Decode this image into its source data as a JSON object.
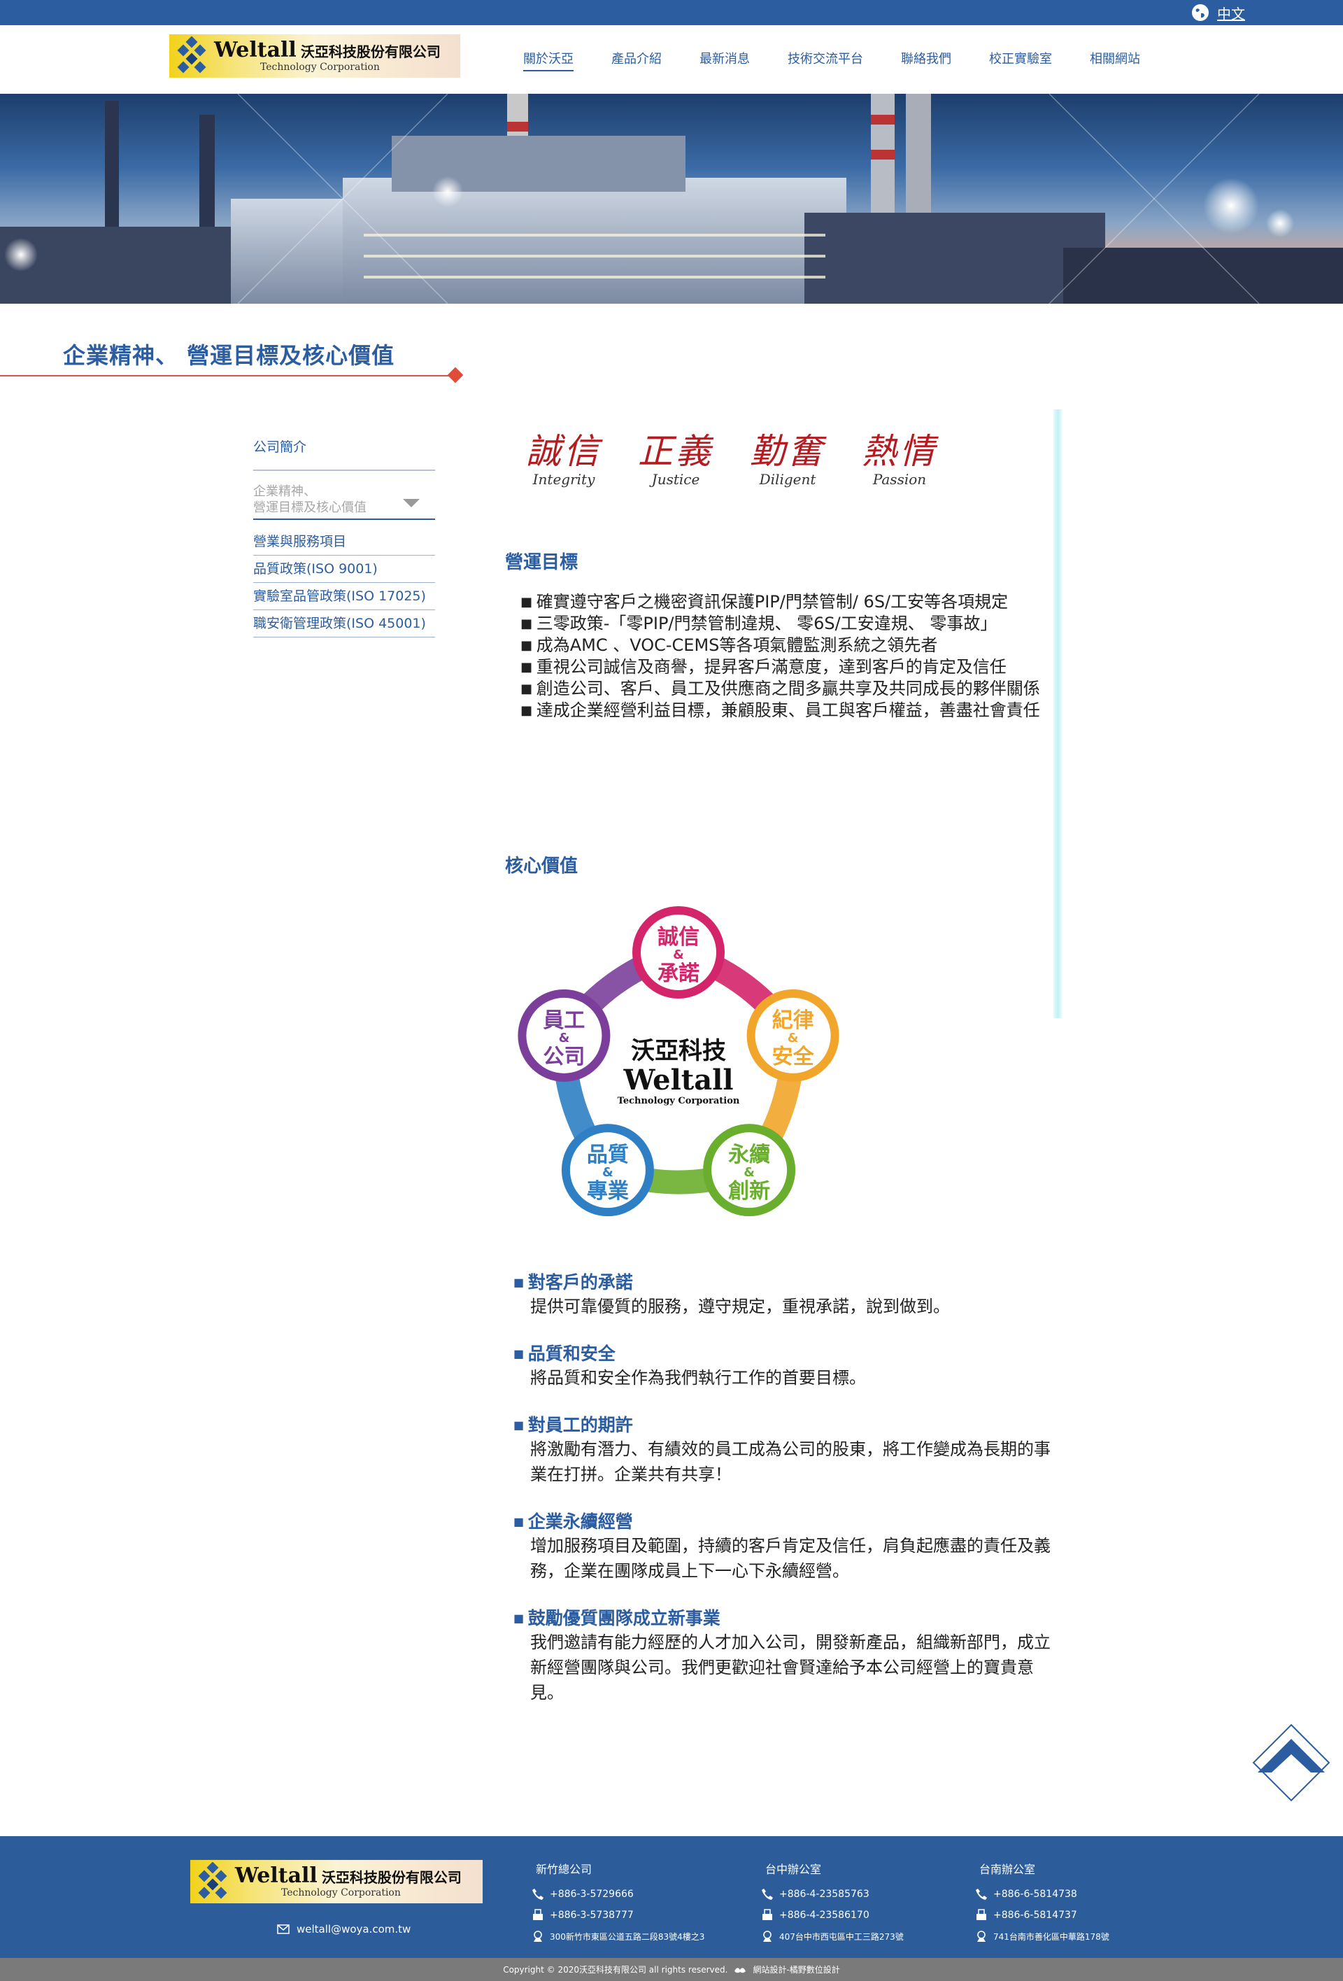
{
  "topbar": {
    "lang_label": "中文",
    "globe_icon": "globe-icon"
  },
  "brand": {
    "logo_en": "Weltall",
    "logo_cn": "沃亞科技股份有限公司",
    "logo_sub": "Technology Corporation"
  },
  "nav": {
    "items": [
      {
        "label": "關於沃亞",
        "active": true
      },
      {
        "label": "產品介紹"
      },
      {
        "label": "最新消息"
      },
      {
        "label": "技術交流平台"
      },
      {
        "label": "聯絡我們"
      },
      {
        "label": "校正實驗室"
      },
      {
        "label": "相關網站"
      }
    ]
  },
  "page": {
    "title": "企業精神、 營運目標及核心價值"
  },
  "sidebar": {
    "items": [
      {
        "label": "公司簡介"
      },
      {
        "label_line1": "企業精神、",
        "label_line2": "營運目標及核心價值",
        "current": true
      },
      {
        "label": "營業與服務項目"
      },
      {
        "label": "品質政策(ISO 9001)"
      },
      {
        "label": "實驗室品管政策(ISO 17025)"
      },
      {
        "label": "職安衛管理政策(ISO 45001)"
      }
    ]
  },
  "values": [
    {
      "cn": "誠信",
      "en": "Integrity"
    },
    {
      "cn": "正義",
      "en": "Justice"
    },
    {
      "cn": "勤奮",
      "en": "Diligent"
    },
    {
      "cn": "熱情",
      "en": "Passion"
    }
  ],
  "goals": {
    "heading": "營運目標",
    "items": [
      "確實遵守客戶之機密資訊保護PIP/門禁管制/ 6S/工安等各項規定",
      "三零政策-「零PIP/門禁管制違規、 零6S/工安違規、 零事故」",
      "成為AMC 、VOC-CEMS等各項氣體監測系統之領先者",
      "重視公司誠信及商譽，提昇客戶滿意度，達到客戶的肯定及信任",
      "創造公司、客戶、員工及供應商之間多贏共享及共同成長的夥伴關係",
      "達成企業經營利益目標，兼顧股東、員工與客戶權益，善盡社會責任"
    ]
  },
  "core": {
    "heading": "核心價值",
    "cycle": {
      "center_cn": "沃亞科技",
      "center_en": "Weltall",
      "center_sub": "Technology Corporation",
      "nodes": [
        {
          "top": "誠信",
          "amp": "&",
          "bottom": "承諾",
          "color": "#d4246a"
        },
        {
          "top": "紀律",
          "amp": "&",
          "bottom": "安全",
          "color": "#f2a52b"
        },
        {
          "top": "永續",
          "amp": "&",
          "bottom": "創新",
          "color": "#6aae2e"
        },
        {
          "top": "品質",
          "amp": "&",
          "bottom": "專業",
          "color": "#2f7fc4"
        },
        {
          "top": "員工",
          "amp": "&",
          "bottom": "公司",
          "color": "#7b3f9b"
        }
      ]
    },
    "commitments": [
      {
        "title": "對客戶的承諾",
        "body": "提供可靠優質的服務，遵守規定，重視承諾，說到做到。"
      },
      {
        "title": "品質和安全",
        "body": "將品質和安全作為我們執行工作的首要目標。"
      },
      {
        "title": "對員工的期許",
        "body": "將激勵有潛力、有績效的員工成為公司的股東，將工作變成為長期的事業在打拼。企業共有共享！"
      },
      {
        "title": "企業永續經營",
        "body": "增加服務項目及範圍，持續的客戶肯定及信任，肩負起應盡的責任及義務，企業在團隊成員上下一心下永續經營。"
      },
      {
        "title": "鼓勵優質團隊成立新事業",
        "body": "我們邀請有能力經歷的人才加入公司，開發新產品，組織新部門，成立新經營團隊與公司。我們更歡迎社會賢達給予本公司經營上的寶貴意見。"
      }
    ]
  },
  "footer": {
    "email": "weltall@woya.com.tw",
    "offices": [
      {
        "name": "新竹總公司",
        "tel": "+886-3-5729666",
        "fax": "+886-3-5738777",
        "addr": "300新竹市東區公道五路二段83號4樓之3"
      },
      {
        "name": "台中辦公室",
        "tel": "+886-4-23585763",
        "fax": "+886-4-23586170",
        "addr": "407台中市西屯區中工三路273號"
      },
      {
        "name": "台南辦公室",
        "tel": "+886-6-5814738",
        "fax": "+886-6-5814737",
        "addr": "741台南市善化區中華路178號"
      }
    ],
    "copyright": "Copyright © 2020沃亞科技有限公司 all rights reserved.",
    "designer": "網站設計-橘野數位設計"
  },
  "colors": {
    "brand_blue": "#2c5da0",
    "accent_red": "#e04b3a",
    "values_red": "#b41c22",
    "footer_bg": "#2c5d9a",
    "copyright_bg": "#7a7a7a"
  }
}
